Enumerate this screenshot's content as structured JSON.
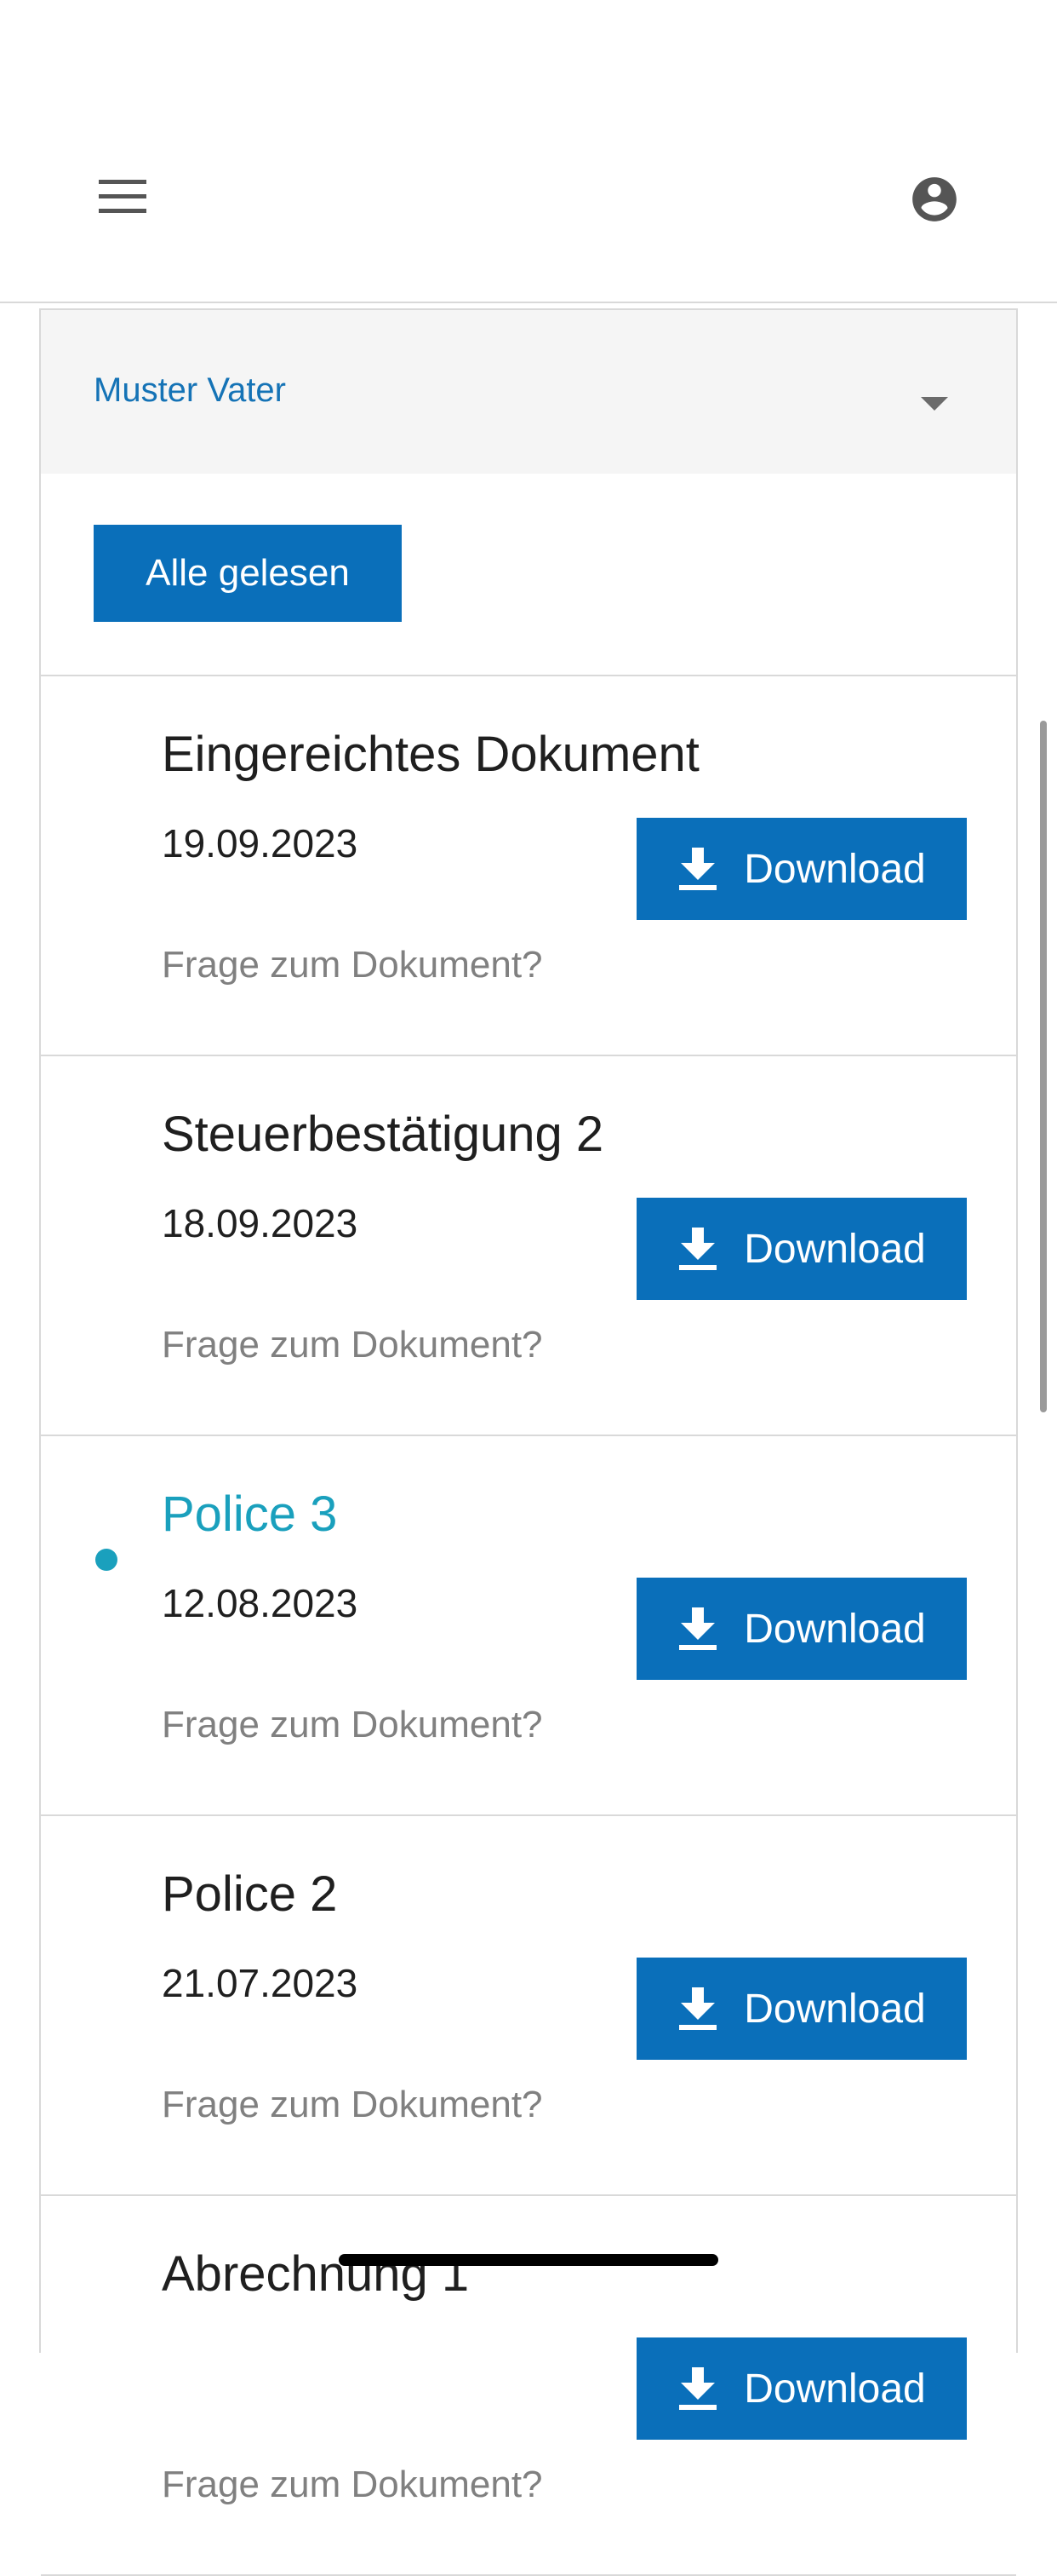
{
  "header": {
    "menu_icon": "hamburger-menu-icon",
    "profile_icon": "account-circle-icon"
  },
  "selector": {
    "selected": "Muster Vater",
    "caret_icon": "caret-down-icon"
  },
  "toolbar": {
    "mark_all_label": "Alle gelesen"
  },
  "documents": [
    {
      "title": "Eingereichtes Dokument",
      "date": "19.09.2023",
      "unread": false,
      "download_label": "Download",
      "question_label": "Frage zum Dokument?"
    },
    {
      "title": "Steuerbestätigung 2",
      "date": "18.09.2023",
      "unread": false,
      "download_label": "Download",
      "question_label": "Frage zum Dokument?"
    },
    {
      "title": "Police 3",
      "date": "12.08.2023",
      "unread": true,
      "download_label": "Download",
      "question_label": "Frage zum Dokument?"
    },
    {
      "title": "Police 2",
      "date": "21.07.2023",
      "unread": false,
      "download_label": "Download",
      "question_label": "Frage zum Dokument?"
    },
    {
      "title": "Abrechnung 1",
      "date": "",
      "unread": false,
      "download_label": "Download",
      "question_label": "Frage zum Dokument?"
    }
  ],
  "colors": {
    "primary": "#0a6fba",
    "link": "#1573b6",
    "unread": "#1aa0bd",
    "muted": "#808080"
  }
}
